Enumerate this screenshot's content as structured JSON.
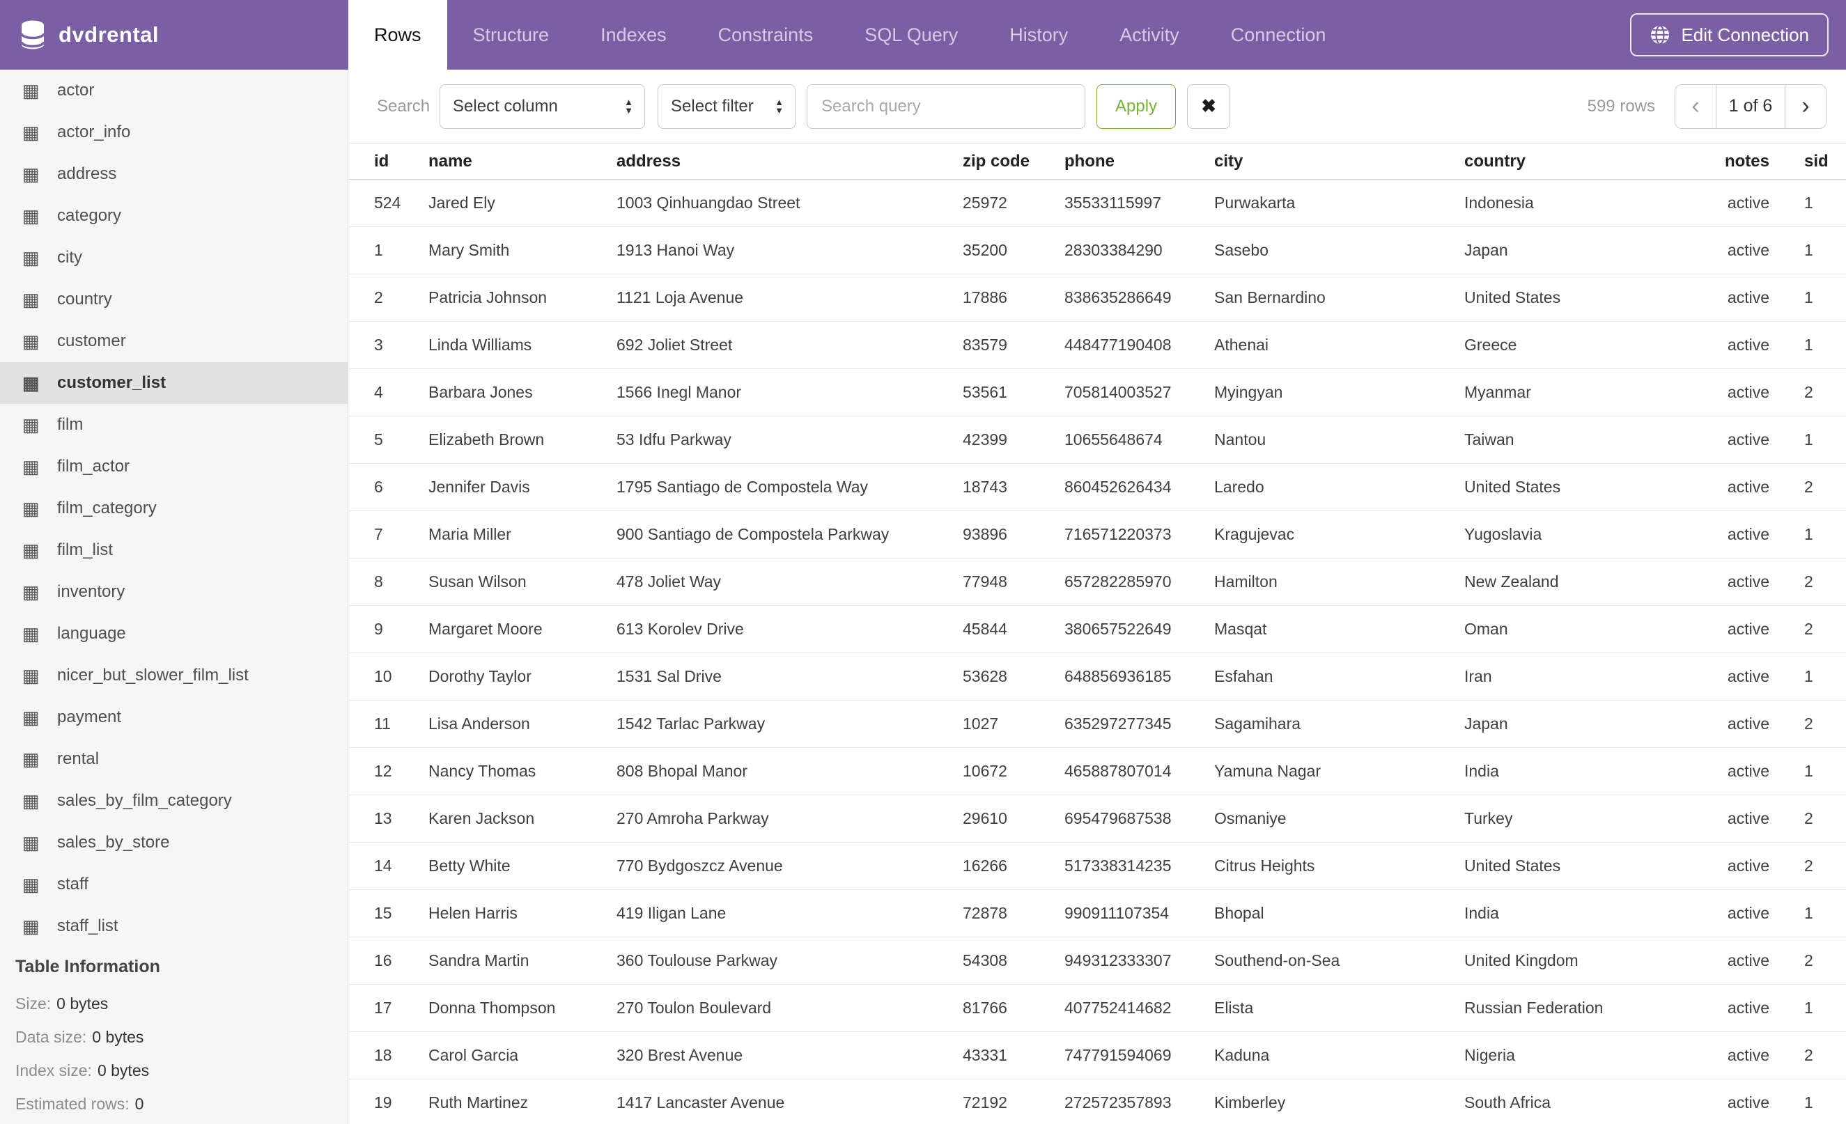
{
  "colors": {
    "header_bg": "#7B5FA4",
    "accent_green": "#74B432"
  },
  "header": {
    "logo_text": "dvdrental",
    "tabs": [
      "Rows",
      "Structure",
      "Indexes",
      "Constraints",
      "SQL Query",
      "History",
      "Activity",
      "Connection"
    ],
    "active_tab": "Rows",
    "edit_connection_label": "Edit Connection"
  },
  "sidebar": {
    "table_icon": "▦",
    "tables": [
      "actor",
      "actor_info",
      "address",
      "category",
      "city",
      "country",
      "customer",
      "customer_list",
      "film",
      "film_actor",
      "film_category",
      "film_list",
      "inventory",
      "language",
      "nicer_but_slower_film_list",
      "payment",
      "rental",
      "sales_by_film_category",
      "sales_by_store",
      "staff",
      "staff_list"
    ],
    "selected_table": "customer_list",
    "info": {
      "title": "Table Information",
      "fields": [
        {
          "label": "Size:",
          "value": "0 bytes"
        },
        {
          "label": "Data size:",
          "value": "0 bytes"
        },
        {
          "label": "Index size:",
          "value": "0 bytes"
        },
        {
          "label": "Estimated rows:",
          "value": "0"
        }
      ]
    }
  },
  "toolbar": {
    "search_label": "Search",
    "column_select_value": "Select column",
    "filter_select_value": "Select filter",
    "query_placeholder": "Search query",
    "query_value": "",
    "apply_label": "Apply",
    "clear_icon": "✖",
    "rows_count": "599 rows",
    "pager": {
      "prev": "‹",
      "page": "1 of 6",
      "next": "›"
    }
  },
  "table": {
    "columns": [
      "id",
      "name",
      "address",
      "zip code",
      "phone",
      "city",
      "country",
      "notes",
      "sid"
    ],
    "rows": [
      [
        "524",
        "Jared Ely",
        "1003 Qinhuangdao Street",
        "25972",
        "35533115997",
        "Purwakarta",
        "Indonesia",
        "active",
        "1"
      ],
      [
        "1",
        "Mary Smith",
        "1913 Hanoi Way",
        "35200",
        "28303384290",
        "Sasebo",
        "Japan",
        "active",
        "1"
      ],
      [
        "2",
        "Patricia Johnson",
        "1121 Loja Avenue",
        "17886",
        "838635286649",
        "San Bernardino",
        "United States",
        "active",
        "1"
      ],
      [
        "3",
        "Linda Williams",
        "692 Joliet Street",
        "83579",
        "448477190408",
        "Athenai",
        "Greece",
        "active",
        "1"
      ],
      [
        "4",
        "Barbara Jones",
        "1566 Inegl Manor",
        "53561",
        "705814003527",
        "Myingyan",
        "Myanmar",
        "active",
        "2"
      ],
      [
        "5",
        "Elizabeth Brown",
        "53 Idfu Parkway",
        "42399",
        "10655648674",
        "Nantou",
        "Taiwan",
        "active",
        "1"
      ],
      [
        "6",
        "Jennifer Davis",
        "1795 Santiago de Compostela Way",
        "18743",
        "860452626434",
        "Laredo",
        "United States",
        "active",
        "2"
      ],
      [
        "7",
        "Maria Miller",
        "900 Santiago de Compostela Parkway",
        "93896",
        "716571220373",
        "Kragujevac",
        "Yugoslavia",
        "active",
        "1"
      ],
      [
        "8",
        "Susan Wilson",
        "478 Joliet Way",
        "77948",
        "657282285970",
        "Hamilton",
        "New Zealand",
        "active",
        "2"
      ],
      [
        "9",
        "Margaret Moore",
        "613 Korolev Drive",
        "45844",
        "380657522649",
        "Masqat",
        "Oman",
        "active",
        "2"
      ],
      [
        "10",
        "Dorothy Taylor",
        "1531 Sal Drive",
        "53628",
        "648856936185",
        "Esfahan",
        "Iran",
        "active",
        "1"
      ],
      [
        "11",
        "Lisa Anderson",
        "1542 Tarlac Parkway",
        "1027",
        "635297277345",
        "Sagamihara",
        "Japan",
        "active",
        "2"
      ],
      [
        "12",
        "Nancy Thomas",
        "808 Bhopal Manor",
        "10672",
        "465887807014",
        "Yamuna Nagar",
        "India",
        "active",
        "1"
      ],
      [
        "13",
        "Karen Jackson",
        "270 Amroha Parkway",
        "29610",
        "695479687538",
        "Osmaniye",
        "Turkey",
        "active",
        "2"
      ],
      [
        "14",
        "Betty White",
        "770 Bydgoszcz Avenue",
        "16266",
        "517338314235",
        "Citrus Heights",
        "United States",
        "active",
        "2"
      ],
      [
        "15",
        "Helen Harris",
        "419 Iligan Lane",
        "72878",
        "990911107354",
        "Bhopal",
        "India",
        "active",
        "1"
      ],
      [
        "16",
        "Sandra Martin",
        "360 Toulouse Parkway",
        "54308",
        "949312333307",
        "Southend-on-Sea",
        "United Kingdom",
        "active",
        "2"
      ],
      [
        "17",
        "Donna Thompson",
        "270 Toulon Boulevard",
        "81766",
        "407752414682",
        "Elista",
        "Russian Federation",
        "active",
        "1"
      ],
      [
        "18",
        "Carol Garcia",
        "320 Brest Avenue",
        "43331",
        "747791594069",
        "Kaduna",
        "Nigeria",
        "active",
        "2"
      ],
      [
        "19",
        "Ruth Martinez",
        "1417 Lancaster Avenue",
        "72192",
        "272572357893",
        "Kimberley",
        "South Africa",
        "active",
        "1"
      ]
    ]
  }
}
